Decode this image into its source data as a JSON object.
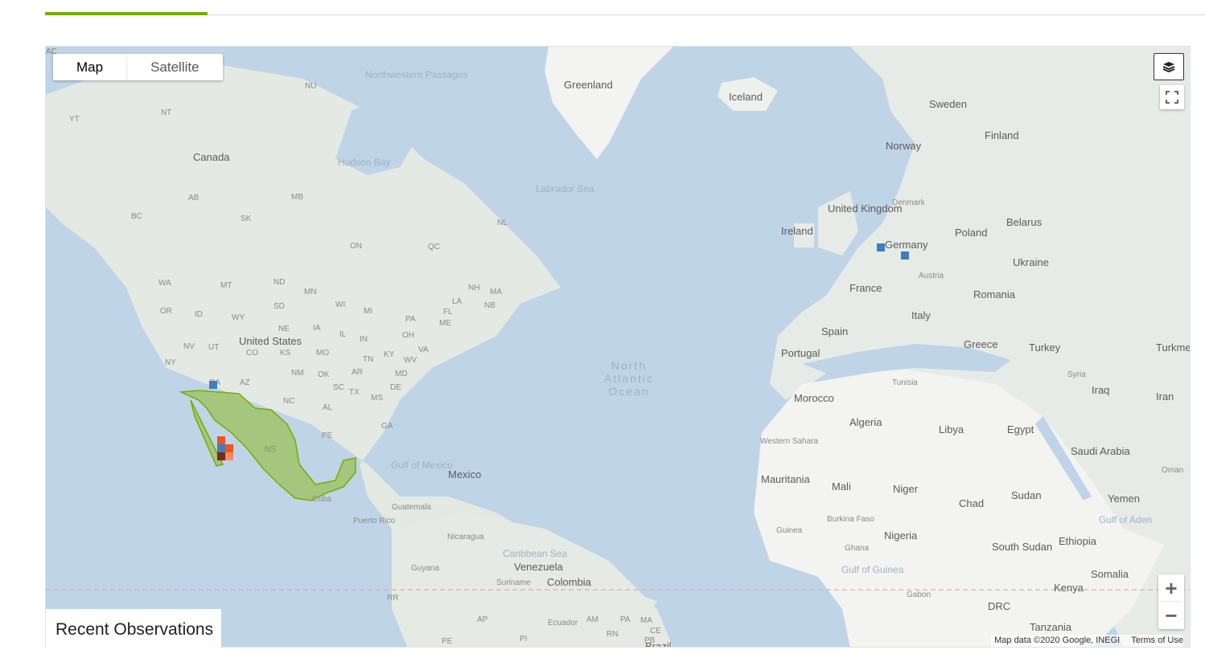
{
  "map_type": {
    "options": [
      "Map",
      "Satellite"
    ],
    "selected": "Map"
  },
  "controls": {
    "layers_icon": "layers-icon",
    "fullscreen_icon": "fullscreen-icon",
    "zoom_in": "+",
    "zoom_out": "−"
  },
  "attribution": {
    "data": "Map data ©2020 Google, INEGI",
    "terms": "Terms of Use"
  },
  "panel_title": "Recent Observations",
  "highlighted_region": {
    "name": "Mexico",
    "color": "#9cc25a"
  },
  "labels": [
    {
      "text": "Greenland",
      "cls": ""
    },
    {
      "text": "Iceland",
      "cls": ""
    },
    {
      "text": "Sweden",
      "cls": ""
    },
    {
      "text": "Finland",
      "cls": ""
    },
    {
      "text": "Norway",
      "cls": ""
    },
    {
      "text": "Northwestern Passages",
      "cls": "sea"
    },
    {
      "text": "Hudson Bay",
      "cls": "sea"
    },
    {
      "text": "Labrador Sea",
      "cls": "sea"
    },
    {
      "text": "Canada",
      "cls": ""
    },
    {
      "text": "NU",
      "cls": "small"
    },
    {
      "text": "YT",
      "cls": "small"
    },
    {
      "text": "NT",
      "cls": "small"
    },
    {
      "text": "AB",
      "cls": "small"
    },
    {
      "text": "BC",
      "cls": "small"
    },
    {
      "text": "MB",
      "cls": "small"
    },
    {
      "text": "SK",
      "cls": "small"
    },
    {
      "text": "ON",
      "cls": "small"
    },
    {
      "text": "QC",
      "cls": "small"
    },
    {
      "text": "NL",
      "cls": "small"
    },
    {
      "text": "Denmark",
      "cls": "small"
    },
    {
      "text": "United Kingdom",
      "cls": ""
    },
    {
      "text": "Ireland",
      "cls": ""
    },
    {
      "text": "Belarus",
      "cls": ""
    },
    {
      "text": "Poland",
      "cls": ""
    },
    {
      "text": "Germany",
      "cls": ""
    },
    {
      "text": "Ukraine",
      "cls": ""
    },
    {
      "text": "Austria",
      "cls": "small"
    },
    {
      "text": "France",
      "cls": ""
    },
    {
      "text": "Romania",
      "cls": ""
    },
    {
      "text": "Italy",
      "cls": ""
    },
    {
      "text": "Spain",
      "cls": ""
    },
    {
      "text": "Portugal",
      "cls": ""
    },
    {
      "text": "Greece",
      "cls": ""
    },
    {
      "text": "Turkey",
      "cls": ""
    },
    {
      "text": "Turkme",
      "cls": ""
    },
    {
      "text": "Syria",
      "cls": "small"
    },
    {
      "text": "Iraq",
      "cls": ""
    },
    {
      "text": "Iran",
      "cls": ""
    },
    {
      "text": "Tunisia",
      "cls": "small"
    },
    {
      "text": "Morocco",
      "cls": ""
    },
    {
      "text": "Algeria",
      "cls": ""
    },
    {
      "text": "Libya",
      "cls": ""
    },
    {
      "text": "Egypt",
      "cls": ""
    },
    {
      "text": "Saudi Arabia",
      "cls": ""
    },
    {
      "text": "Oman",
      "cls": "small"
    },
    {
      "text": "Western Sahara",
      "cls": "small"
    },
    {
      "text": "Mauritania",
      "cls": ""
    },
    {
      "text": "Mali",
      "cls": ""
    },
    {
      "text": "Niger",
      "cls": ""
    },
    {
      "text": "Chad",
      "cls": ""
    },
    {
      "text": "Sudan",
      "cls": ""
    },
    {
      "text": "Yemen",
      "cls": ""
    },
    {
      "text": "Gulf of Aden",
      "cls": "sea"
    },
    {
      "text": "Burkina Faso",
      "cls": "small"
    },
    {
      "text": "Guinea",
      "cls": "small"
    },
    {
      "text": "Nigeria",
      "cls": ""
    },
    {
      "text": "Ghana",
      "cls": "small"
    },
    {
      "text": "South Sudan",
      "cls": ""
    },
    {
      "text": "Ethiopia",
      "cls": ""
    },
    {
      "text": "Gulf of Guinea",
      "cls": "sea"
    },
    {
      "text": "Somalia",
      "cls": ""
    },
    {
      "text": "Kenya",
      "cls": ""
    },
    {
      "text": "Gabon",
      "cls": "small"
    },
    {
      "text": "DRC",
      "cls": ""
    },
    {
      "text": "Tanzania",
      "cls": ""
    },
    {
      "text": "North Atlantic Ocean",
      "cls": "ocean"
    },
    {
      "text": "WA",
      "cls": "small"
    },
    {
      "text": "MT",
      "cls": "small"
    },
    {
      "text": "ND",
      "cls": "small"
    },
    {
      "text": "MN",
      "cls": "small"
    },
    {
      "text": "OR",
      "cls": "small"
    },
    {
      "text": "ID",
      "cls": "small"
    },
    {
      "text": "WY",
      "cls": "small"
    },
    {
      "text": "SD",
      "cls": "small"
    },
    {
      "text": "WI",
      "cls": "small"
    },
    {
      "text": "MI",
      "cls": "small"
    },
    {
      "text": "NE",
      "cls": "small"
    },
    {
      "text": "IA",
      "cls": "small"
    },
    {
      "text": "NV",
      "cls": "small"
    },
    {
      "text": "UT",
      "cls": "small"
    },
    {
      "text": "United States",
      "cls": ""
    },
    {
      "text": "CO",
      "cls": "small"
    },
    {
      "text": "KS",
      "cls": "small"
    },
    {
      "text": "MO",
      "cls": "small"
    },
    {
      "text": "IL",
      "cls": "small"
    },
    {
      "text": "IN",
      "cls": "small"
    },
    {
      "text": "OH",
      "cls": "small"
    },
    {
      "text": "PA",
      "cls": "small"
    },
    {
      "text": "NY",
      "cls": "small"
    },
    {
      "text": "CA",
      "cls": "small"
    },
    {
      "text": "AZ",
      "cls": "small"
    },
    {
      "text": "NM",
      "cls": "small"
    },
    {
      "text": "OK",
      "cls": "small"
    },
    {
      "text": "AR",
      "cls": "small"
    },
    {
      "text": "TN",
      "cls": "small"
    },
    {
      "text": "KY",
      "cls": "small"
    },
    {
      "text": "WV",
      "cls": "small"
    },
    {
      "text": "VA",
      "cls": "small"
    },
    {
      "text": "MD",
      "cls": "small"
    },
    {
      "text": "DE",
      "cls": "small"
    },
    {
      "text": "NC",
      "cls": "small"
    },
    {
      "text": "SC",
      "cls": "small"
    },
    {
      "text": "TX",
      "cls": "small"
    },
    {
      "text": "MS",
      "cls": "small"
    },
    {
      "text": "AL",
      "cls": "small"
    },
    {
      "text": "GA",
      "cls": "small"
    },
    {
      "text": "LA",
      "cls": "small"
    },
    {
      "text": "FL",
      "cls": "small"
    },
    {
      "text": "ME",
      "cls": "small"
    },
    {
      "text": "NH",
      "cls": "small"
    },
    {
      "text": "MA",
      "cls": "small"
    },
    {
      "text": "NB",
      "cls": "small"
    },
    {
      "text": "PE",
      "cls": "small"
    },
    {
      "text": "NS",
      "cls": "small"
    },
    {
      "text": "Gulf of Mexico",
      "cls": "sea"
    },
    {
      "text": "Mexico",
      "cls": ""
    },
    {
      "text": "Cuba",
      "cls": "small"
    },
    {
      "text": "Puerto Rico",
      "cls": "small"
    },
    {
      "text": "Guatemala",
      "cls": "small"
    },
    {
      "text": "Nicaragua",
      "cls": "small"
    },
    {
      "text": "Caribbean Sea",
      "cls": "sea"
    },
    {
      "text": "Venezuela",
      "cls": ""
    },
    {
      "text": "Guyana",
      "cls": "small"
    },
    {
      "text": "Suriname",
      "cls": "small"
    },
    {
      "text": "Colombia",
      "cls": ""
    },
    {
      "text": "RR",
      "cls": "small"
    },
    {
      "text": "AP",
      "cls": "small"
    },
    {
      "text": "Ecuador",
      "cls": "small"
    },
    {
      "text": "AM",
      "cls": "small"
    },
    {
      "text": "PA",
      "cls": "small"
    },
    {
      "text": "MA",
      "cls": "small"
    },
    {
      "text": "CE",
      "cls": "small"
    },
    {
      "text": "RN",
      "cls": "small"
    },
    {
      "text": "PB",
      "cls": "small"
    },
    {
      "text": "PI",
      "cls": "small"
    },
    {
      "text": "PE",
      "cls": "small"
    },
    {
      "text": "Brazil",
      "cls": ""
    },
    {
      "text": "AC",
      "cls": "small"
    },
    {
      "text": "AL",
      "cls": "small"
    }
  ],
  "markers": [
    {
      "name": "observation-marker",
      "color": "#3d7ebf"
    },
    {
      "name": "observation-marker",
      "color": "#3d7ebf"
    },
    {
      "name": "observation-marker",
      "color": "#3d7ebf"
    },
    {
      "name": "observation-marker",
      "color": "#ee5522"
    },
    {
      "name": "observation-marker",
      "color": "#ee5522"
    },
    {
      "name": "observation-marker",
      "color": "#3d7ebf"
    },
    {
      "name": "observation-marker",
      "color": "#ff7744"
    },
    {
      "name": "observation-marker",
      "color": "#7a2a16"
    },
    {
      "name": "observation-marker",
      "color": "#f48a64"
    }
  ]
}
